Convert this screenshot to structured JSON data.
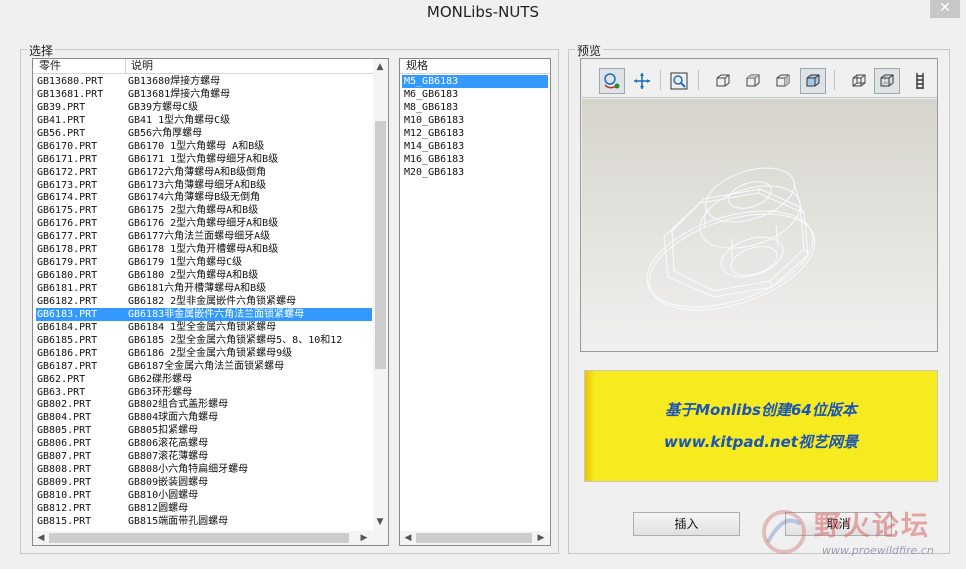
{
  "window": {
    "title": "MONLibs-NUTS",
    "close_glyph": "✕"
  },
  "select_group": {
    "label": "选择",
    "columns": [
      "零件",
      "说明"
    ],
    "rows": [
      {
        "part": "GB13680.PRT",
        "desc": "GB13680焊接方螺母"
      },
      {
        "part": "GB13681.PRT",
        "desc": "GB13681焊接六角螺母"
      },
      {
        "part": "GB39.PRT",
        "desc": "GB39方螺母C级"
      },
      {
        "part": "GB41.PRT",
        "desc": "GB41  1型六角螺母C级"
      },
      {
        "part": "GB56.PRT",
        "desc": "GB56六角厚螺母"
      },
      {
        "part": "GB6170.PRT",
        "desc": "GB6170  1型六角螺母  A和B级"
      },
      {
        "part": "GB6171.PRT",
        "desc": "GB6171  1型六角螺母细牙A和B级"
      },
      {
        "part": "GB6172.PRT",
        "desc": "GB6172六角薄螺母A和B级倒角"
      },
      {
        "part": "GB6173.PRT",
        "desc": "GB6173六角薄螺母细牙A和B级"
      },
      {
        "part": "GB6174.PRT",
        "desc": "GB6174六角薄螺母B级无倒角"
      },
      {
        "part": "GB6175.PRT",
        "desc": "GB6175  2型六角螺母A和B级"
      },
      {
        "part": "GB6176.PRT",
        "desc": "GB6176  2型六角螺母细牙A和B级"
      },
      {
        "part": "GB6177.PRT",
        "desc": "GB6177六角法兰面螺母细牙A级"
      },
      {
        "part": "GB6178.PRT",
        "desc": "GB6178  1型六角开槽螺母A和B级"
      },
      {
        "part": "GB6179.PRT",
        "desc": "GB6179  1型六角螺母C级"
      },
      {
        "part": "GB6180.PRT",
        "desc": "GB6180  2型六角螺母A和B级"
      },
      {
        "part": "GB6181.PRT",
        "desc": "GB6181六角开槽薄螺母A和B级"
      },
      {
        "part": "GB6182.PRT",
        "desc": "GB6182  2型非金属嵌件六角锁紧螺母"
      },
      {
        "part": "GB6183.PRT",
        "desc": "GB6183非金属嵌件六角法兰面锁紧螺母"
      },
      {
        "part": "GB6184.PRT",
        "desc": "GB6184  1型全金属六角锁紧螺母"
      },
      {
        "part": "GB6185.PRT",
        "desc": "GB6185  2型全金属六角锁紧螺母5、8、10和12"
      },
      {
        "part": "GB6186.PRT",
        "desc": "GB6186  2型全金属六角锁紧螺母9级"
      },
      {
        "part": "GB6187.PRT",
        "desc": "GB6187全金属六角法兰面锁紧螺母"
      },
      {
        "part": "GB62.PRT",
        "desc": "GB62碟形螺母"
      },
      {
        "part": "GB63.PRT",
        "desc": "GB63环形螺母"
      },
      {
        "part": "GB802.PRT",
        "desc": "GB802组合式盖形螺母"
      },
      {
        "part": "GB804.PRT",
        "desc": "GB804球面六角螺母"
      },
      {
        "part": "GB805.PRT",
        "desc": "GB805扣紧螺母"
      },
      {
        "part": "GB806.PRT",
        "desc": "GB806滚花高螺母"
      },
      {
        "part": "GB807.PRT",
        "desc": "GB807滚花薄螺母"
      },
      {
        "part": "GB808.PRT",
        "desc": "GB808小六角特扁细牙螺母"
      },
      {
        "part": "GB809.PRT",
        "desc": "GB809嵌装圆螺母"
      },
      {
        "part": "GB810.PRT",
        "desc": "GB810小圆螺母"
      },
      {
        "part": "GB812.PRT",
        "desc": "GB812圆螺母"
      },
      {
        "part": "GB815.PRT",
        "desc": "GB815端面带孔圆螺母"
      }
    ],
    "selected_index": 18
  },
  "spec_list": {
    "header": "规格",
    "items": [
      "M5_GB6183",
      "M6_GB6183",
      "M8_GB6183",
      "M10_GB6183",
      "M12_GB6183",
      "M14_GB6183",
      "M16_GB6183",
      "M20_GB6183"
    ],
    "selected_index": 0
  },
  "preview_group": {
    "label": "预览",
    "toolbar_icons": [
      "spin-icon",
      "pan-icon",
      "zoom-window-icon",
      "view-front-icon",
      "view-top-icon",
      "view-left-icon",
      "view-iso-icon",
      "wireframe-icon",
      "hidden-line-icon",
      "more-icon"
    ],
    "active_icons": [
      "spin-icon",
      "view-iso-icon",
      "hidden-line-icon"
    ]
  },
  "banner": {
    "line1": "基于Monlibs创建64位版本",
    "line2": "www.kitpad.net视艺网景",
    "bg": "#f7ea1f",
    "text_color": "#1b55b5"
  },
  "buttons": {
    "insert": "插入",
    "cancel": "取消"
  },
  "watermark": {
    "text": "野火论坛",
    "url": "www.proewildfire.cn"
  },
  "colors": {
    "selection": "#3399ff",
    "window_bg": "#f0f0f0"
  }
}
